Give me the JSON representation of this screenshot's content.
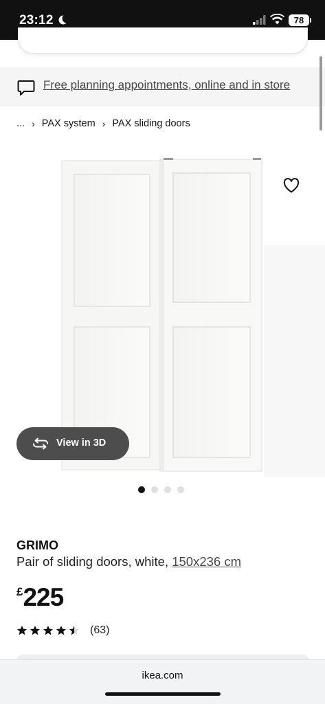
{
  "status_bar": {
    "time": "23:12",
    "battery": "78"
  },
  "banner": {
    "link_text": "Free planning appointments, online and in store"
  },
  "breadcrumb": {
    "ellipsis": "...",
    "items": [
      "PAX system",
      "PAX sliding doors"
    ]
  },
  "gallery": {
    "view3d_label": "View in 3D",
    "dots_total": 4,
    "active_dot": 1
  },
  "product": {
    "name": "GRIMO",
    "description": "Pair of sliding doors, white,",
    "size_link": "150x236 cm",
    "currency": "£",
    "price": "225",
    "rating": 4.5,
    "review_count": "(63)"
  },
  "browser": {
    "url": "ikea.com"
  },
  "colors": {
    "link": "#484848",
    "banner_bg": "#f5f5f5",
    "pill_bg": "#4d4d4d"
  }
}
